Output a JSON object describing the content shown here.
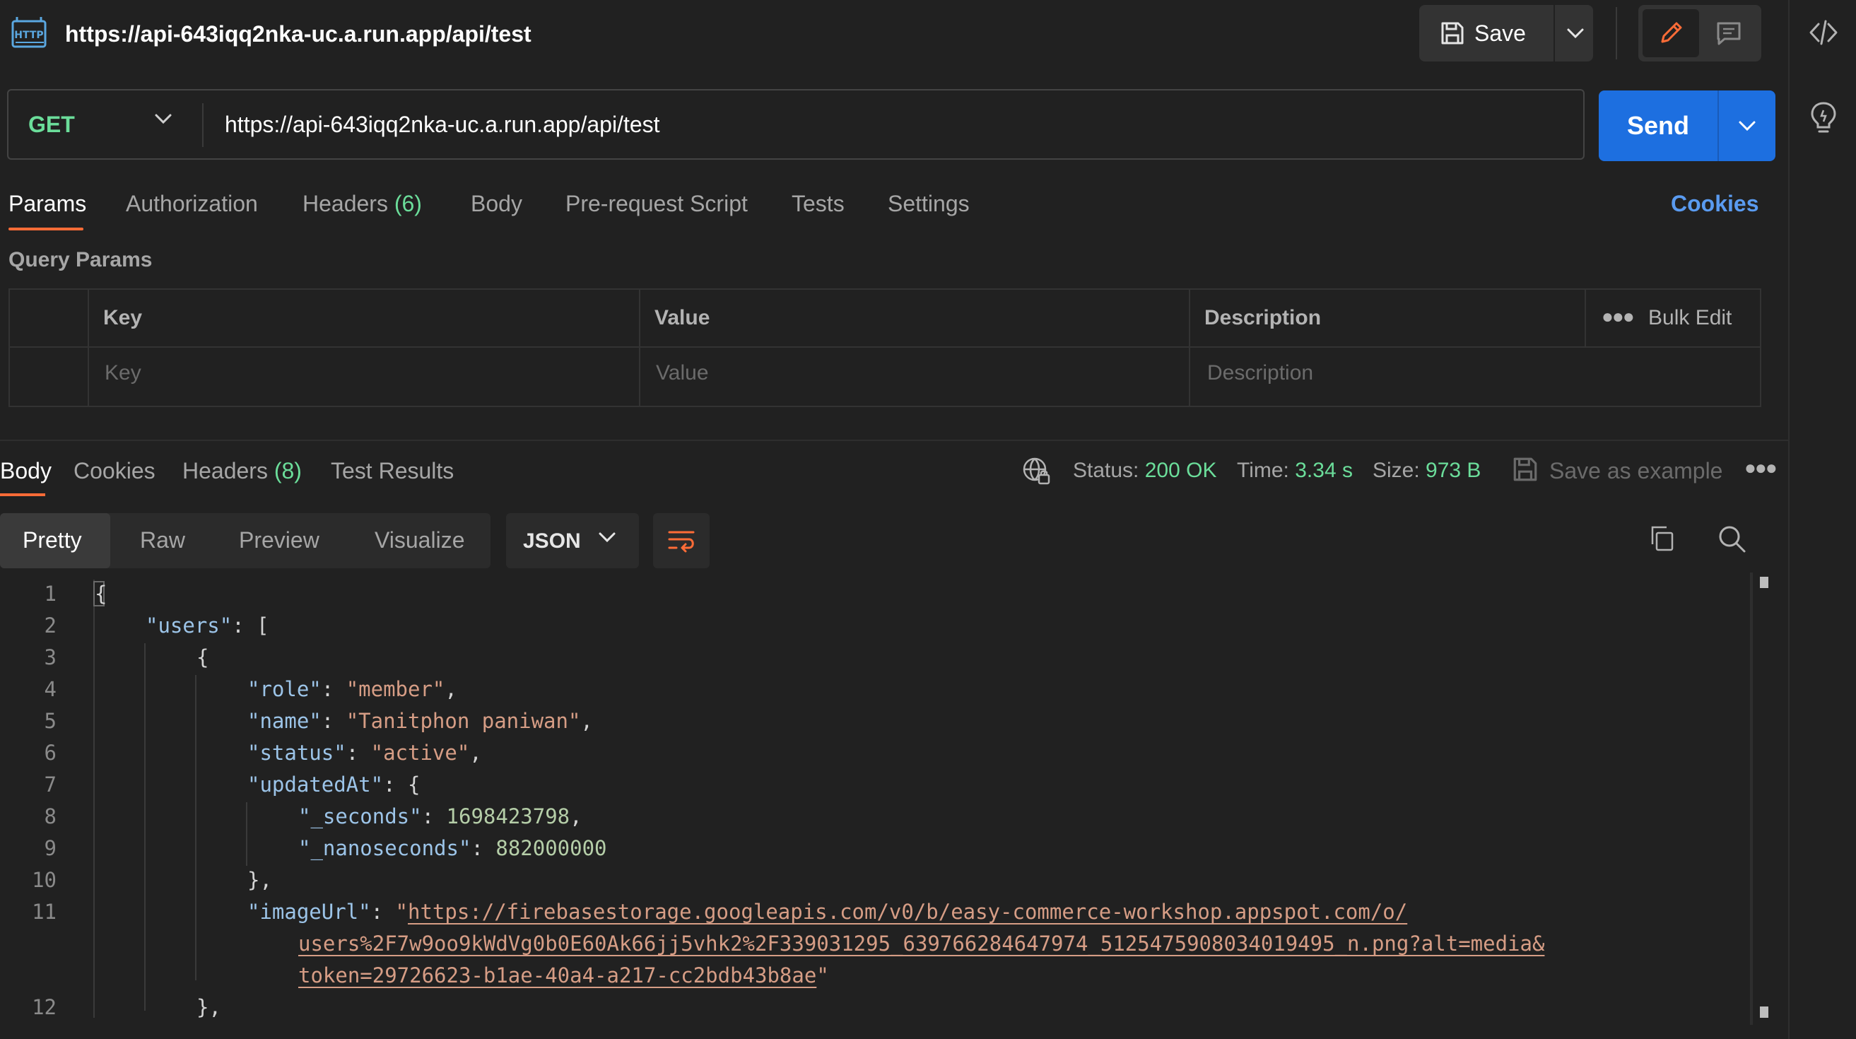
{
  "tab": {
    "title": "https://api-643iqq2nka-uc.a.run.app/api/test",
    "save_label": "Save"
  },
  "request": {
    "method": "GET",
    "url": "https://api-643iqq2nka-uc.a.run.app/api/test",
    "send_label": "Send"
  },
  "request_tabs": {
    "params": "Params",
    "authorization": "Authorization",
    "headers": "Headers",
    "headers_count": "(6)",
    "body": "Body",
    "prerequest": "Pre-request Script",
    "tests": "Tests",
    "settings": "Settings",
    "cookies": "Cookies"
  },
  "query_params": {
    "title": "Query Params",
    "headers": {
      "key": "Key",
      "value": "Value",
      "description": "Description",
      "bulk_edit": "Bulk Edit"
    },
    "placeholders": {
      "key": "Key",
      "value": "Value",
      "description": "Description"
    }
  },
  "response": {
    "tabs": {
      "body": "Body",
      "cookies": "Cookies",
      "headers": "Headers",
      "headers_count": "(8)",
      "test_results": "Test Results"
    },
    "status_label": "Status:",
    "status_value": "200 OK",
    "time_label": "Time:",
    "time_value": "3.34 s",
    "size_label": "Size:",
    "size_value": "973 B",
    "save_example": "Save as example"
  },
  "view": {
    "pretty": "Pretty",
    "raw": "Raw",
    "preview": "Preview",
    "visualize": "Visualize",
    "language": "JSON"
  },
  "code": {
    "line_numbers": [
      "1",
      "2",
      "3",
      "4",
      "5",
      "6",
      "7",
      "8",
      "9",
      "10",
      "11",
      "12"
    ],
    "brace_open": "{",
    "users_key": "\"users\"",
    "users_open": ": [",
    "obj_open": "{",
    "role_key": "\"role\"",
    "role_val": "\"member\"",
    "name_key": "\"name\"",
    "name_val": "\"Tanitphon paniwan\"",
    "status_key": "\"status\"",
    "status_val": "\"active\"",
    "updated_key": "\"updatedAt\"",
    "updated_open": ": {",
    "seconds_key": "\"_seconds\"",
    "seconds_val": "1698423798",
    "nanos_key": "\"_nanoseconds\"",
    "nanos_val": "882000000",
    "updated_close": "},",
    "image_key": "\"imageUrl\"",
    "image_url_1": "https://firebasestorage.googleapis.com/v0/b/easy-commerce-workshop.appspot.com/o/",
    "image_url_2": "users%2F7w9oo9kWdVg0b0E60Ak66jj5vhk2%2F339031295_639766284647974_5125475908034019495_n.png?alt=media&",
    "image_url_3": "token=29726623-b1ae-40a4-a217-cc2bdb43b8ae",
    "obj_close": "},"
  },
  "colors": {
    "accent_orange": "#ff6c37",
    "send_blue": "#1d6fe0",
    "success_green": "#6bdd9a",
    "link_blue": "#5a9bf0"
  }
}
